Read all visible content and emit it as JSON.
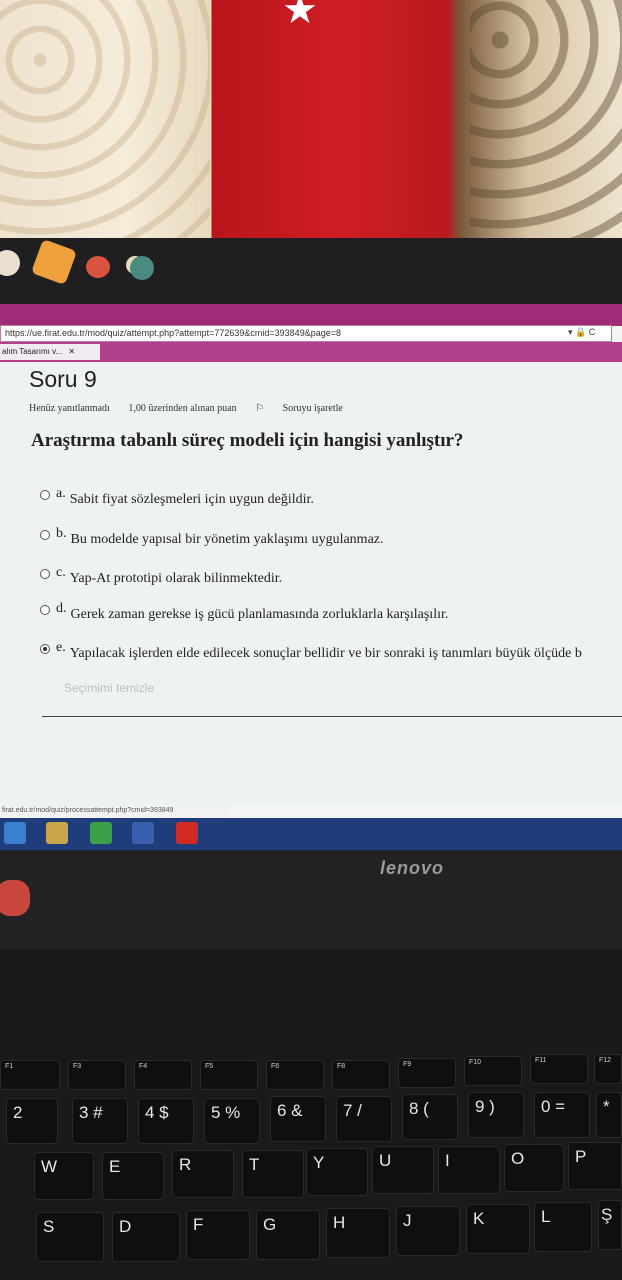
{
  "browser": {
    "url": "https://ue.firat.edu.tr/mod/quiz/attempt.php?attempt=772639&cmid=393849&page=8",
    "tab_title": "alım Tasarımı v...",
    "tab_close": "✕",
    "url_icons": "▾ 🔒 C"
  },
  "quiz": {
    "title": "Soru 9",
    "status": "Henüz yanıtlanmadı",
    "points": "1,00 üzerinden alınan puan",
    "flag": "Soruyu işaretle",
    "question": "Araştırma tabanlı süreç modeli için hangisi yanlıştır?",
    "options": [
      {
        "letter": "a.",
        "text": "Sabit fiyat sözleşmeleri için uygun değildir.",
        "selected": false
      },
      {
        "letter": "b.",
        "text": "Bu modelde yapısal bir yönetim yaklaşımı uygulanmaz.",
        "selected": false
      },
      {
        "letter": "c.",
        "text": "Yap-At prototipi olarak bilinmektedir.",
        "selected": false
      },
      {
        "letter": "d.",
        "text": "Gerek zaman gerekse iş gücü planlamasında zorluklarla karşılaşılır.",
        "selected": false
      },
      {
        "letter": "e.",
        "text": "Yapılacak işlerden elde edilecek sonuçlar bellidir ve bir sonraki iş tanımları büyük ölçüde b",
        "selected": true
      }
    ],
    "clear": "Seçimimi temizle"
  },
  "status_bar": {
    "url": "firat.edu.tr/mod/quiz/processattempt.php?cmid=393849"
  },
  "laptop": {
    "brand": "lenovo"
  },
  "keyboard": {
    "fkeys": [
      "F1",
      "F2",
      "F3",
      "F4",
      "F5",
      "F6",
      "F7",
      "F8",
      "F9",
      "F10",
      "F11",
      "F12"
    ],
    "numbers": [
      "2",
      "3 #",
      "4 $",
      "5 %",
      "6 &",
      "7 /",
      "8 (",
      "9 )",
      "0 =",
      "*"
    ],
    "row_q": [
      "W",
      "E",
      "R",
      "T",
      "Y",
      "U",
      "I",
      "O",
      "P"
    ],
    "row_a": [
      "S",
      "D",
      "F",
      "G",
      "H",
      "J",
      "K",
      "L",
      "Ş"
    ]
  },
  "colors": {
    "browser_accent": "#a02b77",
    "taskbar": "#1e3d7a",
    "flag_red": "#d01d24"
  }
}
